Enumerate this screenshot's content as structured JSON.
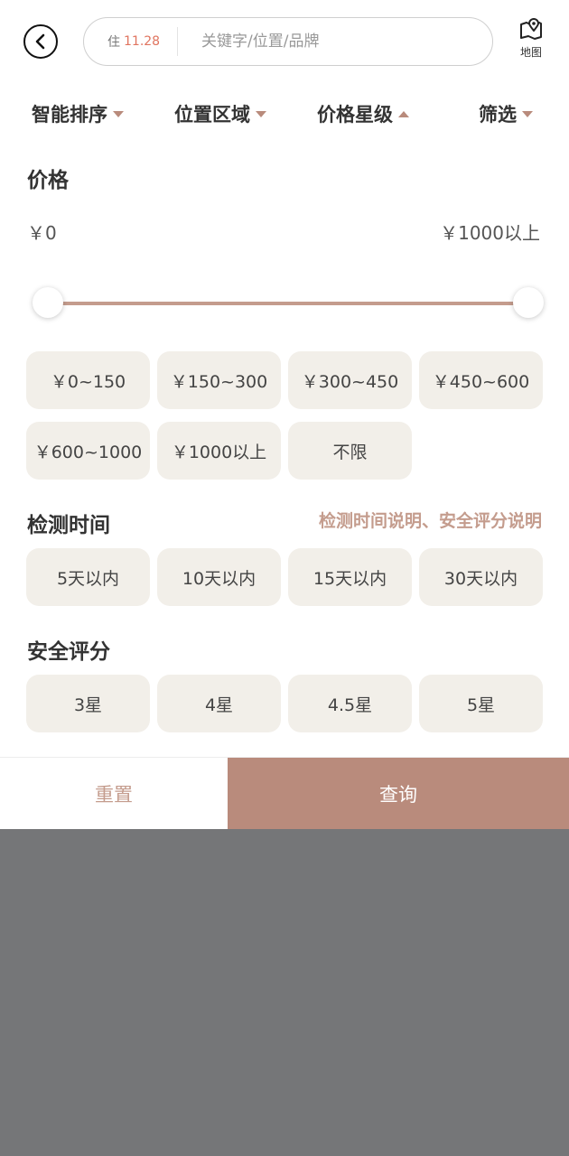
{
  "header": {
    "stay_label": "住",
    "stay_date": "11.28",
    "search_placeholder": "关键字/位置/品牌",
    "map_label": "地图"
  },
  "tabs": [
    {
      "label": "智能排序",
      "caret": "down"
    },
    {
      "label": "位置区域",
      "caret": "down"
    },
    {
      "label": "价格星级",
      "caret": "up",
      "active": true
    },
    {
      "label": "筛选",
      "caret": "down"
    }
  ],
  "price": {
    "title": "价格",
    "min_label": "￥0",
    "max_label": "￥1000以上",
    "slider_range": [
      0,
      1
    ],
    "options": [
      "￥0~150",
      "￥150~300",
      "￥300~450",
      "￥450~600",
      "￥600~1000",
      "￥1000以上",
      "不限"
    ]
  },
  "detection": {
    "title": "检测时间",
    "explain_link": "检测时间说明、安全评分说明",
    "options": [
      "5天以内",
      "10天以内",
      "15天以内",
      "30天以内"
    ]
  },
  "safety": {
    "title": "安全评分",
    "options": [
      "3星",
      "4星",
      "4.5星",
      "5星"
    ]
  },
  "actions": {
    "reset_label": "重置",
    "query_label": "查询"
  },
  "colors": {
    "accent": "#b98b7c",
    "accent_light": "#c49c8d",
    "chip_bg": "#f2efe9",
    "overlay": "#757678",
    "date_highlight": "#e0745f"
  },
  "icons": {
    "back": "back-arrow-circle-icon",
    "map": "map-pin-icon"
  }
}
